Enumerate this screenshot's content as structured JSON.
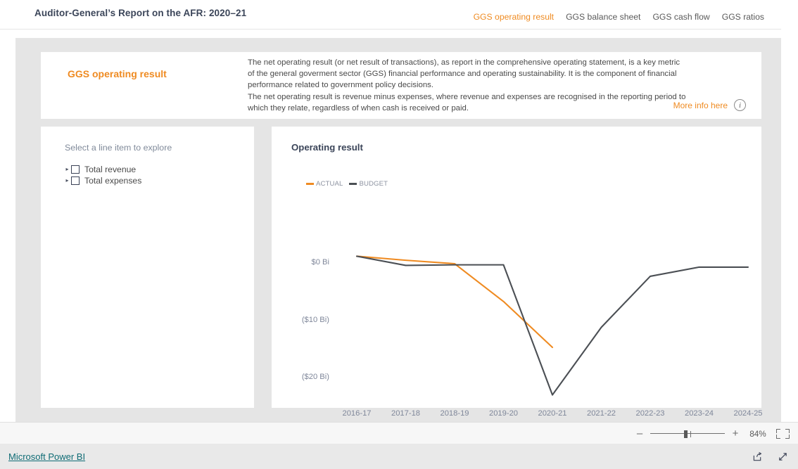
{
  "header": {
    "title": "Auditor-General’s Report on the AFR: 2020–21",
    "tabs": [
      {
        "label": "GGS operating result",
        "active": true
      },
      {
        "label": "GGS balance sheet",
        "active": false
      },
      {
        "label": "GGS cash flow",
        "active": false
      },
      {
        "label": "GGS ratios",
        "active": false
      }
    ]
  },
  "info_card": {
    "title": "GGS operating result",
    "paragraphs": [
      "The net operating result (or net result of transactions), as report in the comprehensive operating statement, is a key metric of the general goverment sector (GGS) financial performance and operating sustainability. It is the component of financial performance related to government policy decisions.",
      "The net operating result is revenue minus expenses, where revenue and expenses are recognised in the reporting period to which they relate, regardless of when cash is received or paid."
    ],
    "more_info_label": "More info here",
    "info_icon": "info-circle-icon"
  },
  "selector": {
    "title": "Select a line item to explore",
    "items": [
      {
        "label": "Total revenue",
        "checked": false,
        "expanded": false
      },
      {
        "label": "Total expenses",
        "checked": false,
        "expanded": false
      }
    ]
  },
  "chart_data": {
    "type": "line",
    "title": "Operating result",
    "xlabel": "",
    "ylabel": "",
    "categories": [
      "2016-17",
      "2017-18",
      "2018-19",
      "2019-20",
      "2020-21",
      "2021-22",
      "2022-23",
      "2023-24",
      "2024-25"
    ],
    "series": [
      {
        "name": "ACTUAL",
        "color": "#ef8b22",
        "values": [
          1.3,
          0.6,
          0.0,
          -6.6,
          -14.6,
          null,
          null,
          null,
          null
        ]
      },
      {
        "name": "BUDGET",
        "color": "#4b4f54",
        "values": [
          1.3,
          -0.3,
          -0.2,
          -0.2,
          -22.9,
          -11.1,
          -2.2,
          -0.6,
          -0.6
        ]
      }
    ],
    "ylim": [
      -25.2,
      2.6
    ],
    "yticks": [
      0,
      -10,
      -20
    ],
    "ytick_labels": [
      "$0 Bi",
      "($10 Bi)",
      "($20 Bi)"
    ],
    "grid": false,
    "legend_position": "top-left",
    "units": "billions of dollars"
  },
  "zoom_bar": {
    "minus": "–",
    "plus": "+",
    "percent": "84%",
    "fit_icon": "fit-to-screen-icon",
    "slider_value": 84
  },
  "footer": {
    "brand": "Microsoft Power BI",
    "share_icon": "share-icon",
    "fullscreen_icon": "fullscreen-icon"
  }
}
